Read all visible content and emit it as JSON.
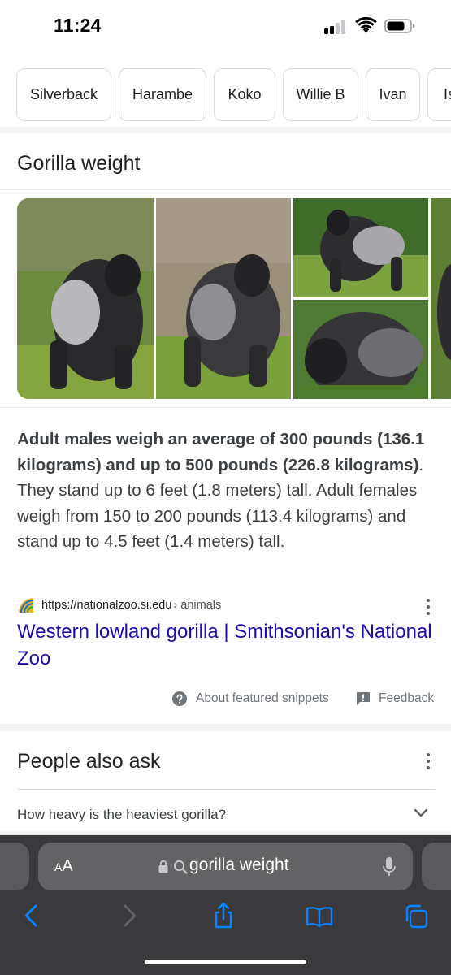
{
  "status_bar": {
    "time": "11:24"
  },
  "chips": [
    "Silverback",
    "Harambe",
    "Koko",
    "Willie B",
    "Ivan",
    "Is"
  ],
  "snippet": {
    "title": "Gorilla weight",
    "bold_text": "Adult males weigh an average of 300 pounds (136.1 kilograms) and up to 500 pounds (226.8 kilograms)",
    "text": ". They stand up to 6 feet (1.8 meters) tall. Adult females weigh from 150 to 200 pounds (113.4 kilograms) and stand up to 4.5 feet (1.4 meters) tall.",
    "source_url": "https://nationalzoo.si.edu",
    "source_path": "› animals",
    "link_title": "Western lowland gorilla | Smithsonian's National Zoo",
    "about_label": "About featured snippets",
    "feedback_label": "Feedback"
  },
  "people_also_ask": {
    "title": "People also ask",
    "questions": [
      "How heavy is the heaviest gorilla?"
    ]
  },
  "browser": {
    "aa_label": "AA",
    "url_text": "gorilla weight"
  },
  "colors": {
    "link": "#1a0dab",
    "browser_bar": "#3a3a3c",
    "url_pill": "#636366",
    "toolbar_icon": "#0a84ff"
  },
  "icons": [
    "question-circle-icon",
    "feedback-icon",
    "kebab-icon",
    "chevron-down-icon",
    "lock-icon",
    "search-icon",
    "microphone-icon",
    "back-icon",
    "forward-icon",
    "share-icon",
    "bookmarks-icon",
    "tabs-icon"
  ]
}
